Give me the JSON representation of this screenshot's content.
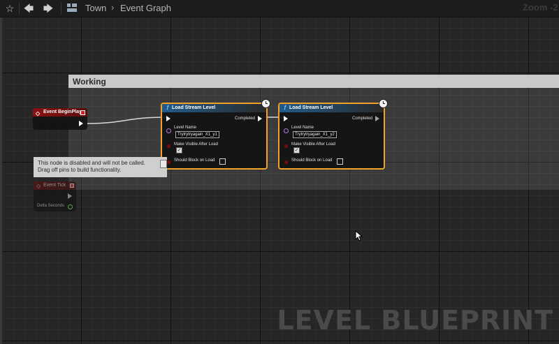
{
  "toolbar": {
    "breadcrumb": [
      "Town",
      "Event Graph"
    ],
    "zoom": "Zoom -2"
  },
  "comment": {
    "title": "Working"
  },
  "nodes": {
    "begin_play": {
      "title": "Event BeginPlay"
    },
    "load1": {
      "title": "Load Stream Level",
      "completed": "Completed",
      "level_name_label": "Level Name",
      "level_name_value": "Trytrytryagain_X1_y1",
      "make_visible_label": "Make Visible After Load",
      "should_block_label": "Should Block on Load"
    },
    "load2": {
      "title": "Load Stream Level",
      "completed": "Completed",
      "level_name_label": "Level Name",
      "level_name_value": "Trytrytryagain_X1_y2",
      "make_visible_label": "Make Visible After Load",
      "should_block_label": "Should Block on Load"
    },
    "event_tick": {
      "title": "Event Tick",
      "delta": "Delta Seconds"
    }
  },
  "tooltip": {
    "line1": "This node is disabled and will not be called.",
    "line2": "Drag off pins to build functionality."
  },
  "watermark": "LEVEL BLUEPRINT",
  "colors": {
    "accent": "#f0a12a",
    "event_red": "#8b1010",
    "function_blue": "#215c8c"
  }
}
